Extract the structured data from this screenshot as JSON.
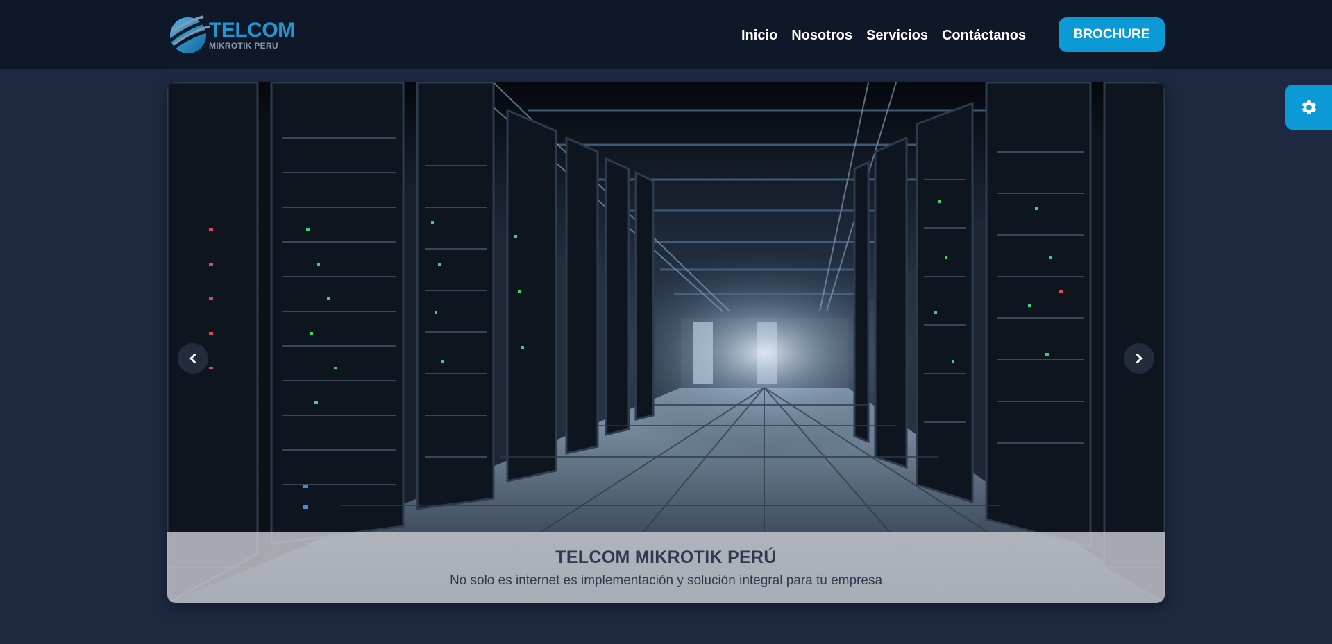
{
  "brand": {
    "name": "TELCOM",
    "tagline": "MIKROTIK PERU",
    "primary_color": "#1e97d3",
    "logo_icon": "globe-swoosh-icon"
  },
  "nav": {
    "items": [
      {
        "label": "Inicio"
      },
      {
        "label": "Nosotros"
      },
      {
        "label": "Servicios"
      },
      {
        "label": "Contáctanos"
      }
    ],
    "cta_label": "BROCHURE",
    "cta_color": "#0b9ad6"
  },
  "settings": {
    "icon": "gear-icon",
    "color": "#0b9ad6"
  },
  "hero": {
    "slide_image": "server-room-corridor",
    "caption_title": "TELCOM MIKROTIK PERÚ",
    "caption_text": "No solo es internet es implementación y solución integral para tu empresa",
    "prev_icon": "chevron-left-icon",
    "next_icon": "chevron-right-icon"
  },
  "colors": {
    "page_background": "#1d2940",
    "header_background": "#0f1829"
  }
}
